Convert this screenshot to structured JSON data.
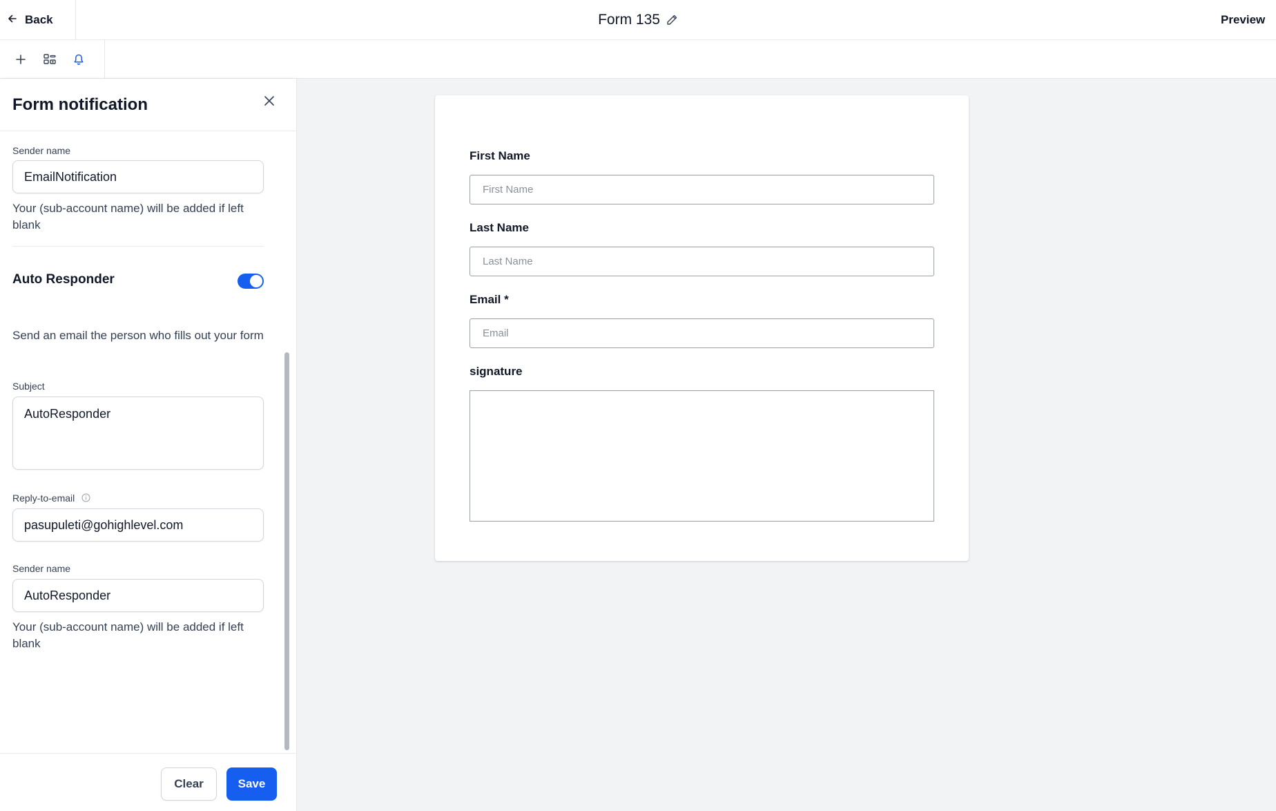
{
  "header": {
    "back_label": "Back",
    "form_title": "Form 135",
    "preview_label": "Preview"
  },
  "toolbar": {
    "icons": [
      "plus-icon",
      "fields-icon",
      "bell-icon"
    ],
    "active_icon_color": "#155eef"
  },
  "panel": {
    "title": "Form notification",
    "email_notification": {
      "sender_name_label": "Sender name",
      "sender_name_value": "EmailNotification",
      "sender_name_help": "Your (sub-account name) will be added if left blank"
    },
    "auto_responder": {
      "title": "Auto Responder",
      "enabled": true,
      "description": "Send an email the person who fills out your form",
      "subject_label": "Subject",
      "subject_value": "AutoResponder",
      "reply_to_label": "Reply-to-email",
      "reply_to_value": "pasupuleti@gohighlevel.com",
      "sender_name_label": "Sender name",
      "sender_name_value": "AutoResponder",
      "sender_name_help": "Your (sub-account name) will be added if left blank"
    },
    "footer": {
      "clear_label": "Clear",
      "save_label": "Save"
    }
  },
  "form_preview": {
    "fields": [
      {
        "label": "First Name",
        "placeholder": "First Name"
      },
      {
        "label": "Last Name",
        "placeholder": "Last Name"
      },
      {
        "label": "Email *",
        "placeholder": "Email"
      },
      {
        "label": "signature",
        "placeholder": ""
      }
    ]
  },
  "colors": {
    "primary": "#155eef",
    "canvas_bg": "#f2f3f5",
    "border": "#d0d5dd"
  }
}
